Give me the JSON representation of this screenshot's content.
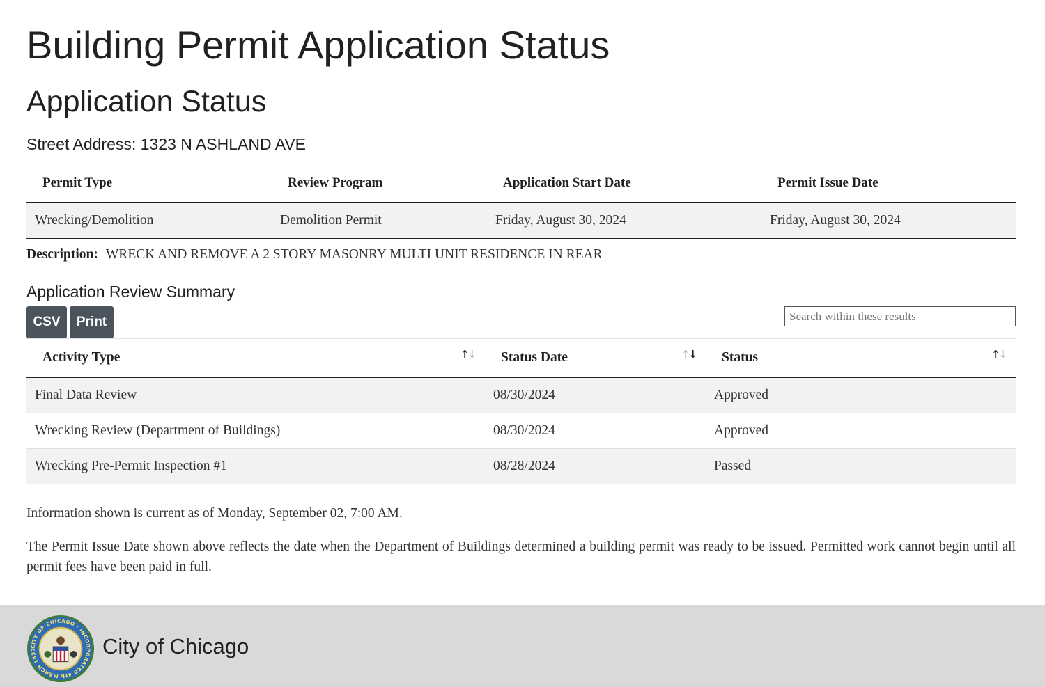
{
  "page": {
    "title": "Building Permit Application Status",
    "section_title": "Application Status"
  },
  "address": {
    "label": "Street Address:",
    "value": "1323 N ASHLAND AVE"
  },
  "permit": {
    "headers": [
      "Permit Type",
      "Review Program",
      "Application Start Date",
      "Permit Issue Date"
    ],
    "row": [
      "Wrecking/Demolition",
      "Demolition Permit",
      "Friday, August 30, 2024",
      "Friday, August 30, 2024"
    ]
  },
  "description": {
    "label": "Description:",
    "value": "WRECK AND REMOVE A 2 STORY MASONRY MULTI UNIT RESIDENCE IN REAR"
  },
  "review": {
    "title": "Application Review Summary",
    "buttons": {
      "csv": "CSV",
      "print": "Print"
    },
    "search_placeholder": "Search within these results",
    "headers": [
      "Activity Type",
      "Status Date",
      "Status"
    ],
    "rows": [
      [
        "Final Data Review",
        "08/30/2024",
        "Approved"
      ],
      [
        "Wrecking Review (Department of Buildings)",
        "08/30/2024",
        "Approved"
      ],
      [
        "Wrecking Pre-Permit Inspection #1",
        "08/28/2024",
        "Passed"
      ]
    ]
  },
  "notes": {
    "current_as_of": "Information shown is current as of Monday, September 02, 7:00 AM.",
    "disclaimer": "The Permit Issue Date shown above reflects the date when the Department of Buildings determined a building permit was ready to be issued. Permitted work cannot begin until all permit fees have been paid in full."
  },
  "footer": {
    "name": "City of Chicago",
    "seal_icon": "city-of-chicago-seal-icon",
    "seal_text": "CITY OF CHICAGO · INCORPORATED 4th MARCH 1837"
  },
  "colors": {
    "button_bg": "#4b535c",
    "row_stripe": "#f2f2f2",
    "footer_bg": "#d9d9d9"
  }
}
